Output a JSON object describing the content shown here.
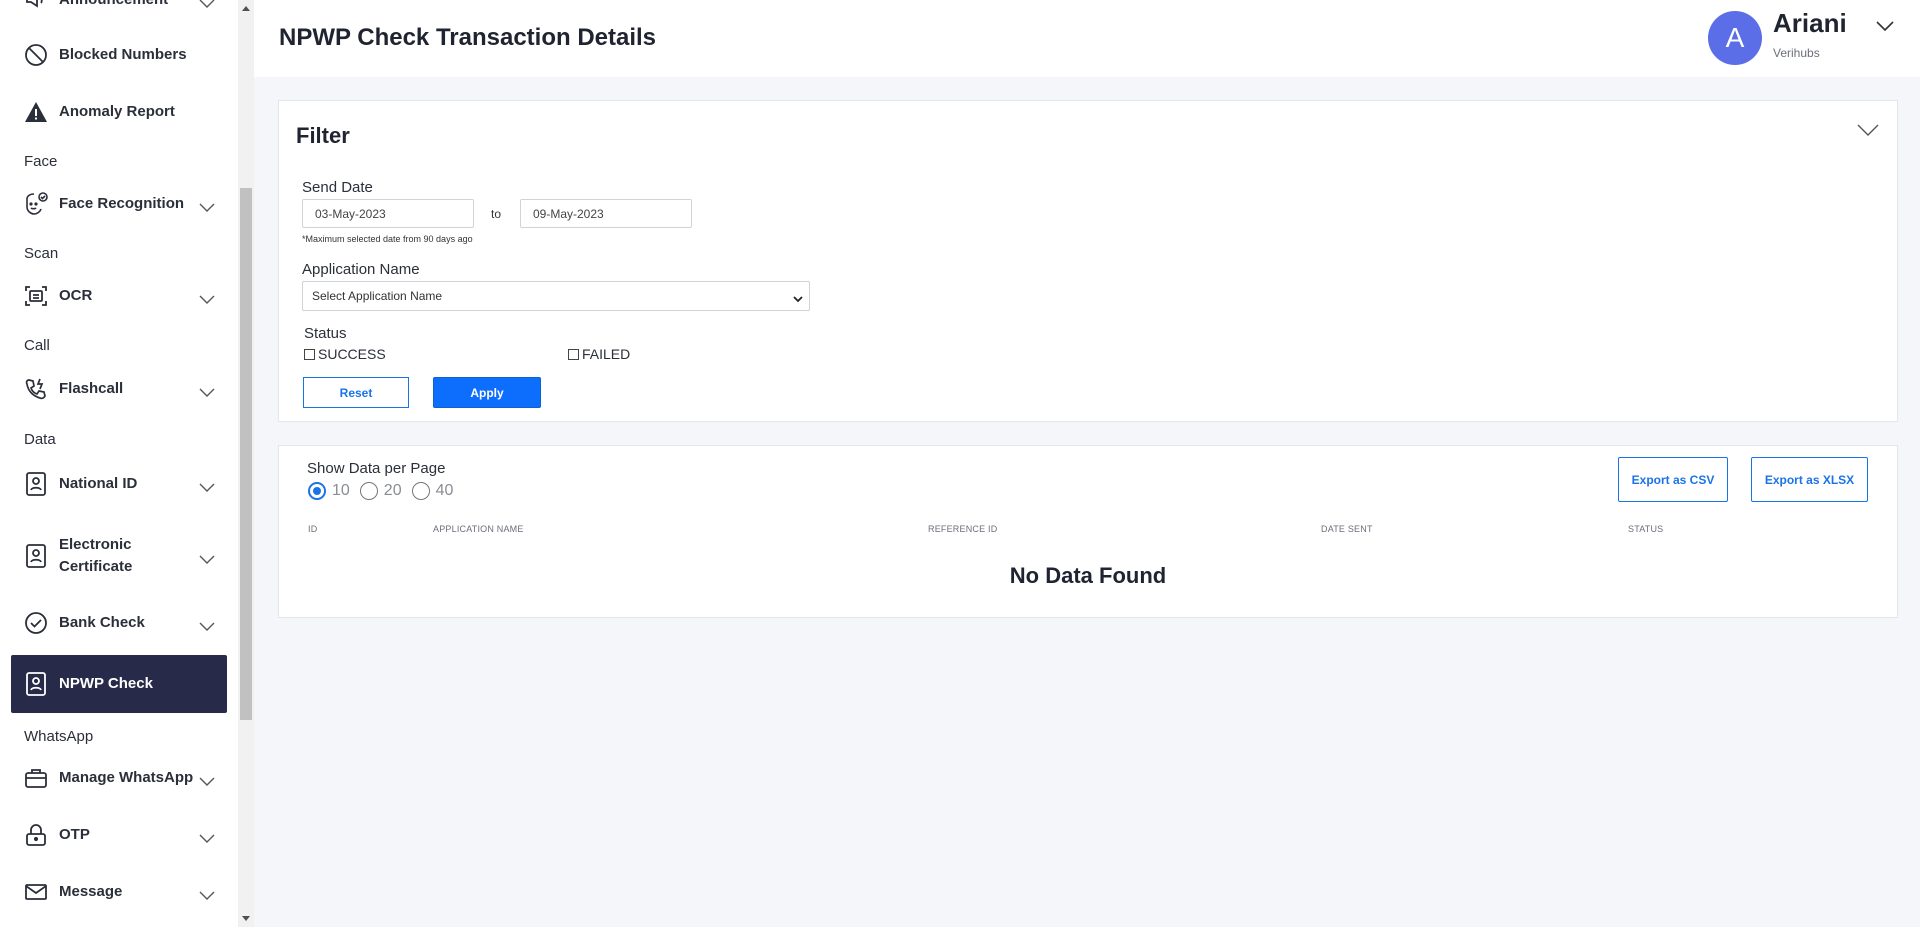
{
  "sidebar": {
    "top_item": "Announcement",
    "blocked": "Blocked Numbers",
    "anomaly": "Anomaly Report",
    "sections": {
      "face": "Face",
      "scan": "Scan",
      "call": "Call",
      "data": "Data",
      "whatsapp": "WhatsApp"
    },
    "items": {
      "face_recognition": "Face Recognition",
      "ocr": "OCR",
      "flashcall": "Flashcall",
      "national_id": "National ID",
      "electronic_certificate_1": "Electronic",
      "electronic_certificate_2": "Certificate",
      "bank_check": "Bank Check",
      "npwp_check": "NPWP Check",
      "manage_whatsapp": "Manage WhatsApp",
      "otp": "OTP",
      "message": "Message"
    },
    "active_item": "NPWP Check"
  },
  "header": {
    "title": "NPWP Check Transaction Details",
    "user": {
      "initial": "A",
      "name": "Ariani",
      "org": "Verihubs"
    }
  },
  "filter": {
    "title": "Filter",
    "send_date_label": "Send Date",
    "date_from": "03-May-2023",
    "to_label": "to",
    "date_to": "09-May-2023",
    "date_hint": "*Maximum selected date from 90 days ago",
    "app_name_label": "Application Name",
    "app_name_selected": "Select Application Name",
    "status_label": "Status",
    "status_options": [
      "SUCCESS",
      "FAILED"
    ],
    "status_checked": [
      false,
      false
    ],
    "reset_label": "Reset",
    "apply_label": "Apply"
  },
  "results": {
    "per_page_label": "Show Data per Page",
    "per_page_options": [
      "10",
      "20",
      "40"
    ],
    "per_page_selected": "10",
    "export_csv": "Export as CSV",
    "export_xlsx": "Export as XLSX",
    "columns": [
      "ID",
      "APPLICATION NAME",
      "REFERENCE ID",
      "DATE SENT",
      "STATUS"
    ],
    "rows": [],
    "empty_text": "No Data Found"
  },
  "colors": {
    "active_nav_bg": "#272a48",
    "primary": "#0d6efd",
    "avatar": "#5b6ee8"
  }
}
